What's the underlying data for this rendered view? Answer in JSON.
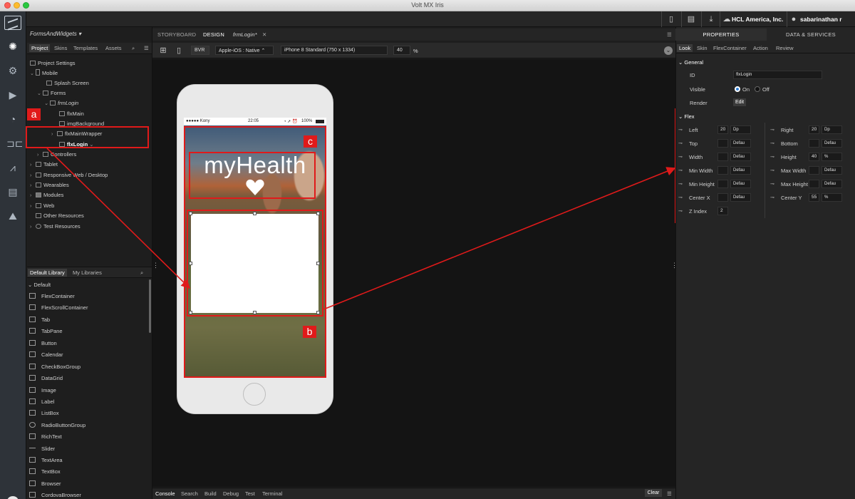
{
  "window": {
    "title": "Volt MX Iris"
  },
  "header": {
    "company": "HCL America, Inc.",
    "user": "sabarinathan r"
  },
  "project": {
    "name": "FormsAndWidgets",
    "tabs": [
      "Project",
      "Skins",
      "Templates",
      "Assets"
    ],
    "tree": {
      "project_settings": "Project Settings",
      "mobile": "Mobile",
      "splash": "Splash Screen",
      "forms": "Forms",
      "frmLogin": "frmLogin",
      "flxMain": "flxMain",
      "imgBackground": "imgBackground",
      "flxMainWrapper": "flxMainWrapper",
      "flxLogin": "flxLogin",
      "controllers": "Controllers",
      "tablet": "Tablet",
      "responsive": "Responsive Web / Desktop",
      "wearables": "Wearables",
      "modules": "Modules",
      "web": "Web",
      "other": "Other Resources",
      "test": "Test Resources"
    }
  },
  "library": {
    "tabs": [
      "Default Library",
      "My Libraries"
    ],
    "group": "Default",
    "items": [
      "FlexContainer",
      "FlexScrollContainer",
      "Tab",
      "TabPane",
      "Button",
      "Calendar",
      "CheckBoxGroup",
      "DataGrid",
      "Image",
      "Label",
      "ListBox",
      "RadioButtonGroup",
      "RichText",
      "Slider",
      "TextArea",
      "TextBox",
      "Browser",
      "CordovaBrowser"
    ]
  },
  "editor": {
    "tabs": [
      "STORYBOARD",
      "DESIGN",
      "frmLogin*"
    ],
    "bvr": "BVR",
    "platform": "Apple-iOS : Native",
    "device": "iPhone 8 Standard (750 x 1334)",
    "zoom": "40",
    "zoom_unit": "%"
  },
  "phone": {
    "carrier": "●●●●● Kony",
    "time": "22:05",
    "battery": "100%",
    "app_title": "myHealth"
  },
  "annotations": {
    "a": "a",
    "b": "b",
    "c": "c"
  },
  "console": {
    "tabs": [
      "Console",
      "Search",
      "Build",
      "Debug",
      "Test",
      "Terminal"
    ],
    "clear": "Clear"
  },
  "properties": {
    "tabs": [
      "PROPERTIES",
      "DATA & SERVICES"
    ],
    "subtabs": [
      "Look",
      "Skin",
      "FlexContainer",
      "Action",
      "Review"
    ],
    "general": {
      "title": "General",
      "id_label": "ID",
      "id_value": "flxLogin",
      "visible_label": "Visible",
      "on": "On",
      "off": "Off",
      "render_label": "Render",
      "edit": "Edit"
    },
    "flex": {
      "title": "Flex",
      "left": {
        "label": "Left",
        "value": "20",
        "unit": "Dp"
      },
      "top": {
        "label": "Top",
        "value": "",
        "unit": "Defau"
      },
      "width": {
        "label": "Width",
        "value": "",
        "unit": "Defau"
      },
      "min_width": {
        "label": "Min Width",
        "value": "",
        "unit": "Defau"
      },
      "min_height": {
        "label": "Min Height",
        "value": "",
        "unit": "Defau"
      },
      "center_x": {
        "label": "Center X",
        "value": "",
        "unit": "Defau"
      },
      "z_index": {
        "label": "Z Index",
        "value": "2"
      },
      "right": {
        "label": "Right",
        "value": "20",
        "unit": "Dp"
      },
      "bottom": {
        "label": "Bottom",
        "value": "",
        "unit": "Defau"
      },
      "height": {
        "label": "Height",
        "value": "40",
        "unit": "%"
      },
      "max_width": {
        "label": "Max Width",
        "value": "",
        "unit": "Defau"
      },
      "max_height": {
        "label": "Max Height",
        "value": "",
        "unit": "Defau"
      },
      "center_y": {
        "label": "Center Y",
        "value": "55",
        "unit": "%"
      }
    }
  },
  "colors": {
    "annotation": "#e01a1a",
    "accent_radio": "#2f7fd6"
  }
}
